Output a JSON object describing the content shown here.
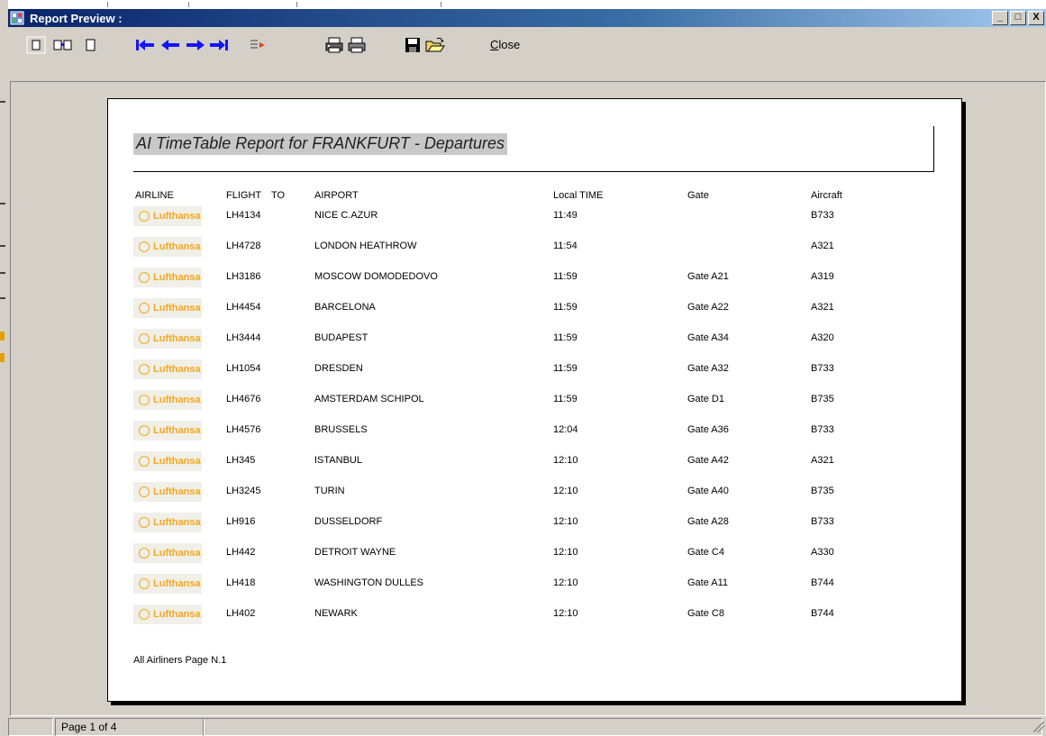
{
  "window": {
    "title": "Report Preview :",
    "minimize": "_",
    "maximize": "□",
    "close": "X"
  },
  "toolbar": {
    "close_label": "Close",
    "close_mnemonic": "C",
    "close_rest": "lose",
    "icons": [
      "single-page-icon",
      "two-pages-icon",
      "full-page-icon",
      "first-page-icon",
      "previous-page-icon",
      "next-page-icon",
      "last-page-icon",
      "goto-page-icon",
      "print-setup-icon",
      "print-icon",
      "save-icon",
      "open-icon"
    ]
  },
  "colors": {
    "arrow_blue": "#1414ff",
    "lufthansa_yellow": "#f5a81c",
    "title_bg": "#c8c8c8"
  },
  "report": {
    "title": "AI TimeTable Report for FRANKFURT - Departures",
    "columns": {
      "airline": "AIRLINE",
      "flight": "FLIGHT",
      "to": "TO",
      "airport": "AIRPORT",
      "local_time": "Local TIME",
      "gate": "Gate",
      "aircraft": "Aircraft"
    },
    "rows": [
      {
        "airline": "Lufthansa",
        "flight": "LH4134",
        "airport": "NICE C.AZUR",
        "time": "11:49",
        "gate": "",
        "aircraft": "B733"
      },
      {
        "airline": "Lufthansa",
        "flight": "LH4728",
        "airport": "LONDON HEATHROW",
        "time": "11:54",
        "gate": "",
        "aircraft": "A321"
      },
      {
        "airline": "Lufthansa",
        "flight": "LH3186",
        "airport": "MOSCOW DOMODEDOVO",
        "time": "11:59",
        "gate": "Gate A21",
        "aircraft": "A319"
      },
      {
        "airline": "Lufthansa",
        "flight": "LH4454",
        "airport": "BARCELONA",
        "time": "11:59",
        "gate": "Gate A22",
        "aircraft": "A321"
      },
      {
        "airline": "Lufthansa",
        "flight": "LH3444",
        "airport": "BUDAPEST",
        "time": "11:59",
        "gate": "Gate A34",
        "aircraft": "A320"
      },
      {
        "airline": "Lufthansa",
        "flight": "LH1054",
        "airport": "DRESDEN",
        "time": "11:59",
        "gate": "Gate A32",
        "aircraft": "B733"
      },
      {
        "airline": "Lufthansa",
        "flight": "LH4676",
        "airport": "AMSTERDAM SCHIPOL",
        "time": "11:59",
        "gate": "Gate D1",
        "aircraft": "B735"
      },
      {
        "airline": "Lufthansa",
        "flight": "LH4576",
        "airport": "BRUSSELS",
        "time": "12:04",
        "gate": "Gate A36",
        "aircraft": "B733"
      },
      {
        "airline": "Lufthansa",
        "flight": "LH345",
        "airport": "ISTANBUL",
        "time": "12:10",
        "gate": "Gate A42",
        "aircraft": "A321"
      },
      {
        "airline": "Lufthansa",
        "flight": "LH3245",
        "airport": "TURIN",
        "time": "12:10",
        "gate": "Gate A40",
        "aircraft": "B735"
      },
      {
        "airline": "Lufthansa",
        "flight": "LH916",
        "airport": "DUSSELDORF",
        "time": "12:10",
        "gate": "Gate A28",
        "aircraft": "B733"
      },
      {
        "airline": "Lufthansa",
        "flight": "LH442",
        "airport": "DETROIT WAYNE",
        "time": "12:10",
        "gate": "Gate C4",
        "aircraft": "A330"
      },
      {
        "airline": "Lufthansa",
        "flight": "LH418",
        "airport": "WASHINGTON DULLES",
        "time": "12:10",
        "gate": "Gate A11",
        "aircraft": "B744"
      },
      {
        "airline": "Lufthansa",
        "flight": "LH402",
        "airport": "NEWARK",
        "time": "12:10",
        "gate": "Gate C8",
        "aircraft": "B744"
      }
    ],
    "footer": "All Airliners Page N.1"
  },
  "status": {
    "page": "Page 1 of 4"
  }
}
